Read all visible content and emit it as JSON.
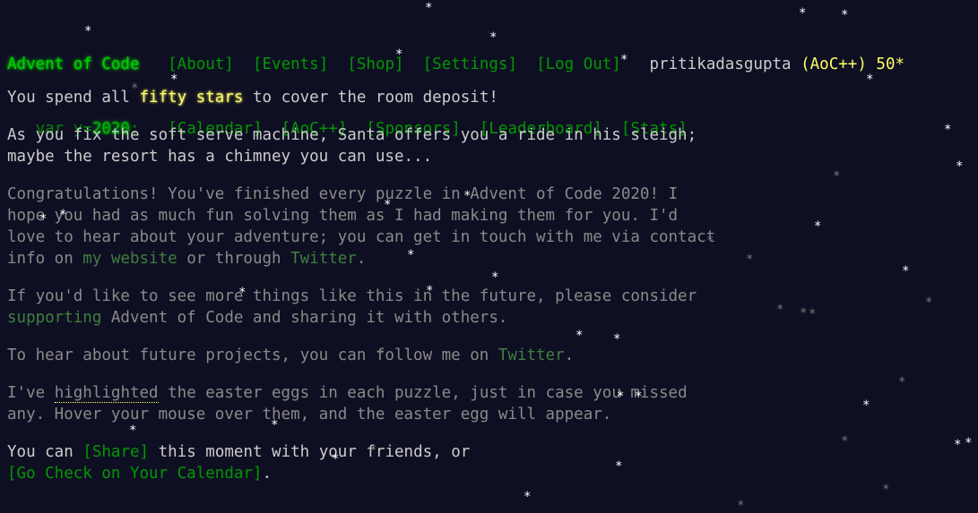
{
  "header": {
    "logo": "Advent of Code",
    "year_prefix": "var y=",
    "year_value": "2020",
    "year_suffix": ";",
    "nav_row1": [
      "[About]",
      "[Events]",
      "[Shop]",
      "[Settings]",
      "[Log Out]"
    ],
    "nav_row2": [
      "[Calendar]",
      "[AoC++]",
      "[Sponsors]",
      "[Leaderboard]",
      "[Stats]"
    ],
    "username": "pritikadasgupta",
    "supporter": "(AoC++)",
    "star_count": "50*"
  },
  "main": {
    "p1_pre": "You spend all ",
    "p1_hl": "fifty stars",
    "p1_post": " to cover the room deposit!",
    "p2_line1": "As you fix the soft serve machine, Santa offers you a ride in his sleigh;",
    "p2_line2": "maybe the resort has a chimney you can use...",
    "p3_line1": "Congratulations! You've finished every puzzle in Advent of Code 2020! I",
    "p3_line2": "hope you had as much fun solving them as I had making them for you. I'd",
    "p3_line3": "love to hear about your adventure; you can get in touch with me via contact",
    "p3_line4_pre": "info on ",
    "p3_link_website": "my website",
    "p3_mid": " or through ",
    "p3_link_twitter": "Twitter",
    "p3_end": ".",
    "p4_line1": "If you'd like to see more things like this in the future, please consider",
    "p4_link_supporting": "supporting",
    "p4_post": " Advent of Code and sharing it with others.",
    "p5_pre": "To hear about future projects, you can follow me on ",
    "p5_link_twitter": "Twitter",
    "p5_end": ".",
    "p6_pre": "I've ",
    "p6_hl": "highlighted",
    "p6_line1_post": " the easter eggs in each puzzle, just in case you missed",
    "p6_line2": "any. Hover your mouse over them, and the easter egg will appear.",
    "p7_pre": "You can ",
    "p7_share": "[Share]",
    "p7_post": " this moment with your friends, or",
    "p7_calendar": "[Go Check on Your Calendar]",
    "p7_end": "."
  },
  "snow_glyph": "*"
}
